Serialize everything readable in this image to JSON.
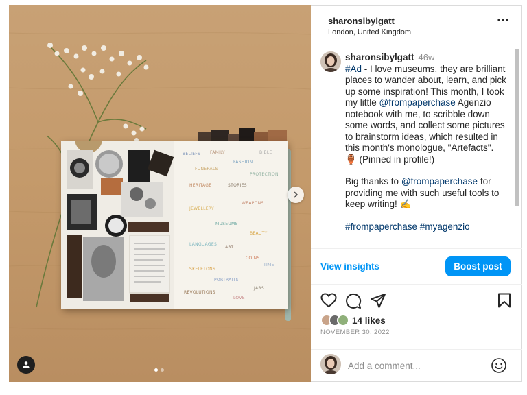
{
  "post": {
    "username": "sharonsibylgatt",
    "location": "London, United Kingdom",
    "notebook_words": [
      "BELIEFS",
      "FAMILY",
      "BIBLE",
      "FUNERALS",
      "FASHION",
      "PROTECTION",
      "HERITAGE",
      "STORIES",
      "JEWELLERY",
      "WEAPONS",
      "MUSEUMS",
      "BEAUTY",
      "LANGUAGES",
      "ART",
      "COINS",
      "TIME",
      "SKELETONS",
      "PORTRAITS",
      "REVOLUTIONS",
      "LOVE",
      "JARS"
    ]
  },
  "caption": {
    "username": "sharonsibylgatt",
    "time": "46w",
    "hashtag_ad": "#Ad",
    "text_1": " - I love museums, they are brilliant places to wander about, learn, and pick up some inspiration! This month, I took my little ",
    "mention_1": "@frompaperchase",
    "text_2": " Agenzio notebook with me, to scribble down some words, and collect some pictures to brainstorm ideas, which resulted in this month's monologue, \"Artefacts\". 🏺 (Pinned in profile!)",
    "text_3": "Big thanks to ",
    "mention_2": "@frompaperchase",
    "text_4": " for providing me with such useful tools to keep writing! ✍️",
    "tags": "#frompaperchase #myagenzio"
  },
  "insights": {
    "view_label": "View insights",
    "boost_label": "Boost post"
  },
  "engagement": {
    "likes": "14 likes",
    "date": "NOVEMBER 30, 2022"
  },
  "comment": {
    "placeholder": "Add a comment..."
  },
  "colors": {
    "accent": "#0095f6",
    "link": "#00376b",
    "muted": "#8e8e8e"
  },
  "icons": [
    "more-options-icon",
    "next-arrow-icon",
    "user-tag-icon",
    "like-heart-icon",
    "comment-icon",
    "share-icon",
    "save-bookmark-icon",
    "emoji-icon"
  ]
}
